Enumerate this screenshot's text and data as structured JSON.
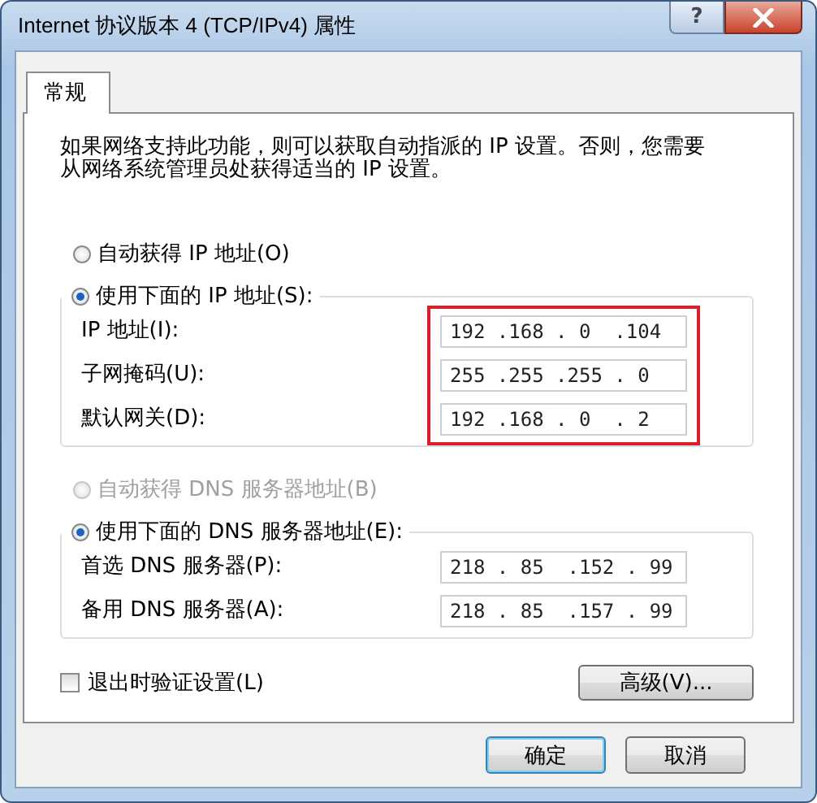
{
  "window": {
    "title": "Internet 协议版本 4 (TCP/IPv4) 属性",
    "help_button": "?"
  },
  "tabs": [
    {
      "label": "常规",
      "selected": true
    }
  ],
  "description": "如果网络支持此功能，则可以获取自动指派的 IP 设置。否则，您需要从网络系统管理员处获得适当的 IP 设置。",
  "ip_mode": [
    {
      "label": "自动获得 IP 地址(O)",
      "selected": false,
      "disabled": false
    },
    {
      "label": "使用下面的 IP 地址(S):",
      "selected": true,
      "disabled": false
    }
  ],
  "ip_settings": {
    "highlight": true,
    "fields": [
      {
        "label": "IP 地址(I):",
        "value": "192 .168 . 0  .104"
      },
      {
        "label": "子网掩码(U):",
        "value": "255 .255 .255 . 0"
      },
      {
        "label": "默认网关(D):",
        "value": "192 .168 . 0  . 2"
      }
    ]
  },
  "dns_mode": [
    {
      "label": "自动获得 DNS 服务器地址(B)",
      "selected": false,
      "disabled": true
    },
    {
      "label": "使用下面的 DNS 服务器地址(E):",
      "selected": true,
      "disabled": false
    }
  ],
  "dns_settings": {
    "highlight": false,
    "fields": [
      {
        "label": "首选 DNS 服务器(P):",
        "value": "218 . 85  .152 . 99"
      },
      {
        "label": "备用 DNS 服务器(A):",
        "value": "218 . 85  .157 . 99"
      }
    ]
  },
  "validate_on_exit": {
    "label": "退出时验证设置(L)",
    "checked": false
  },
  "advanced_button": "高级(V)...",
  "buttons": [
    "确定",
    "取消"
  ]
}
